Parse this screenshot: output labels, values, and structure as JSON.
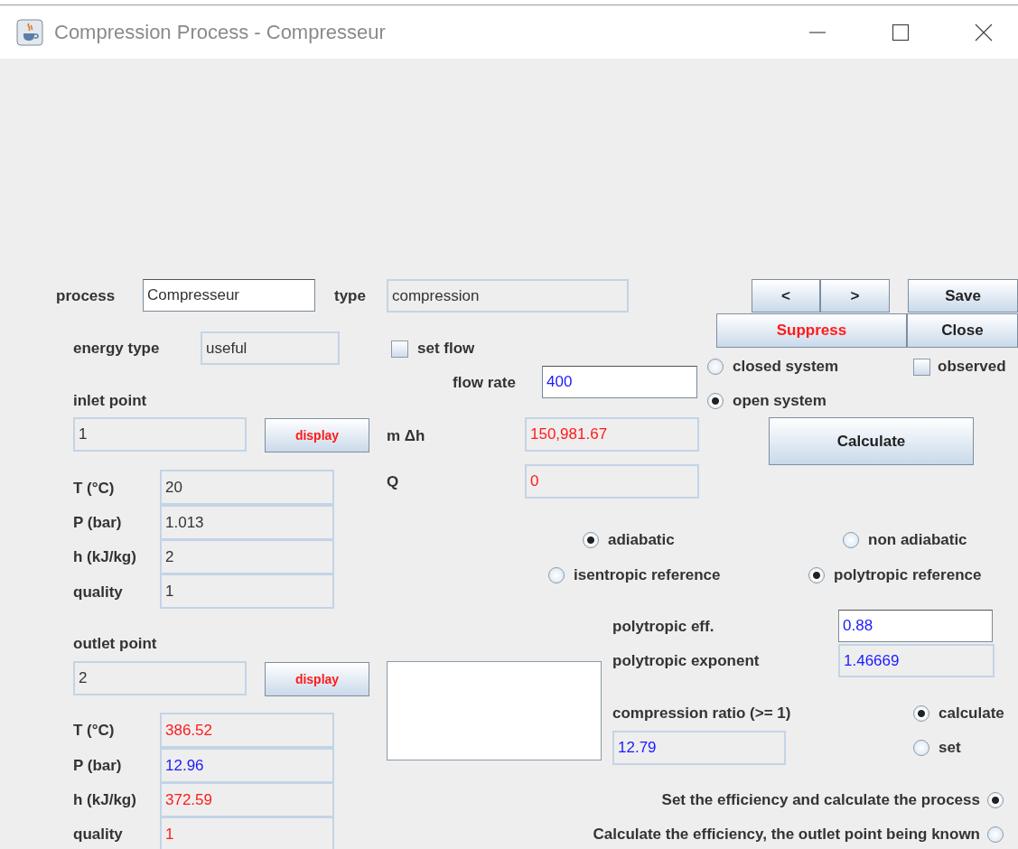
{
  "window": {
    "title": "Compression Process - Compresseur"
  },
  "process": {
    "label": "process",
    "value": "Compresseur",
    "editable": true,
    "color": "#333333"
  },
  "type": {
    "label": "type",
    "value": "compression",
    "editable": false,
    "color": "#333333"
  },
  "buttons": [
    {
      "label": "<",
      "kind": "normal"
    },
    {
      "label": ">",
      "kind": "normal"
    },
    {
      "label": "Save",
      "kind": "normal"
    },
    {
      "label": "Suppress",
      "kind": "danger"
    },
    {
      "label": "Close",
      "kind": "normal"
    }
  ],
  "energy_type": {
    "label": "energy type",
    "value": "useful",
    "editable": false,
    "color": "#333333"
  },
  "set_flow": {
    "label": "set flow",
    "checked": false
  },
  "system": [
    {
      "label": "closed system",
      "selected": false
    },
    {
      "label": "open system",
      "selected": true
    }
  ],
  "observed": {
    "label": "observed",
    "checked": false
  },
  "flow_rate": {
    "label": "flow rate",
    "value": "400",
    "editable": true,
    "color": "#1a1aff"
  },
  "inlet": {
    "label": "inlet point",
    "value": "1",
    "editable": false,
    "color": "#333333",
    "button": "display",
    "properties": [
      {
        "label": "T (°C)",
        "value": "20",
        "color": "#333333"
      },
      {
        "label": "P (bar)",
        "value": "1.013",
        "color": "#333333"
      },
      {
        "label": "h (kJ/kg)",
        "value": "2",
        "color": "#333333"
      },
      {
        "label": "quality",
        "value": "1",
        "color": "#333333"
      }
    ]
  },
  "m_delta_h": {
    "label": "m Δh",
    "value": "150,981.67",
    "editable": false,
    "color": "#ff1a1a"
  },
  "calculate_button": "Calculate",
  "q": {
    "label": "Q",
    "value": "0",
    "editable": false,
    "color": "#ff1a1a"
  },
  "heat_exchange": [
    {
      "label": "adiabatic",
      "selected": true
    },
    {
      "label": "non adiabatic",
      "selected": false
    }
  ],
  "reference": [
    {
      "label": "isentropic reference",
      "selected": false
    },
    {
      "label": "polytropic reference",
      "selected": true
    }
  ],
  "polytropic_eff": {
    "label": "polytropic eff.",
    "value": "0.88",
    "editable": true,
    "color": "#1a1aff"
  },
  "outlet": {
    "label": "outlet point",
    "value": "2",
    "editable": false,
    "color": "#333333",
    "button": "display",
    "properties": [
      {
        "label": "T (°C)",
        "value": "386.52",
        "color": "#ff1a1a"
      },
      {
        "label": "P (bar)",
        "value": "12.96",
        "color": "#1a1aff"
      },
      {
        "label": "h (kJ/kg)",
        "value": "372.59",
        "color": "#ff1a1a"
      },
      {
        "label": "quality",
        "value": "1",
        "color": "#ff1a1a"
      }
    ]
  },
  "polytropic_exponent": {
    "label": "polytropic exponent",
    "value": "1.46669",
    "editable": false,
    "color": "#1a1aff"
  },
  "compression_ratio": {
    "label": "compression ratio (>= 1)",
    "value": "12.79",
    "editable": false,
    "color": "#1a1aff"
  },
  "ratio_mode": [
    {
      "label": "calculate",
      "selected": true
    },
    {
      "label": "set",
      "selected": false
    }
  ],
  "calculation_mode": [
    {
      "label": "Set the efficiency and calculate the process",
      "selected": true
    },
    {
      "label": "Calculate the efficiency, the outlet point being known",
      "selected": false
    }
  ]
}
